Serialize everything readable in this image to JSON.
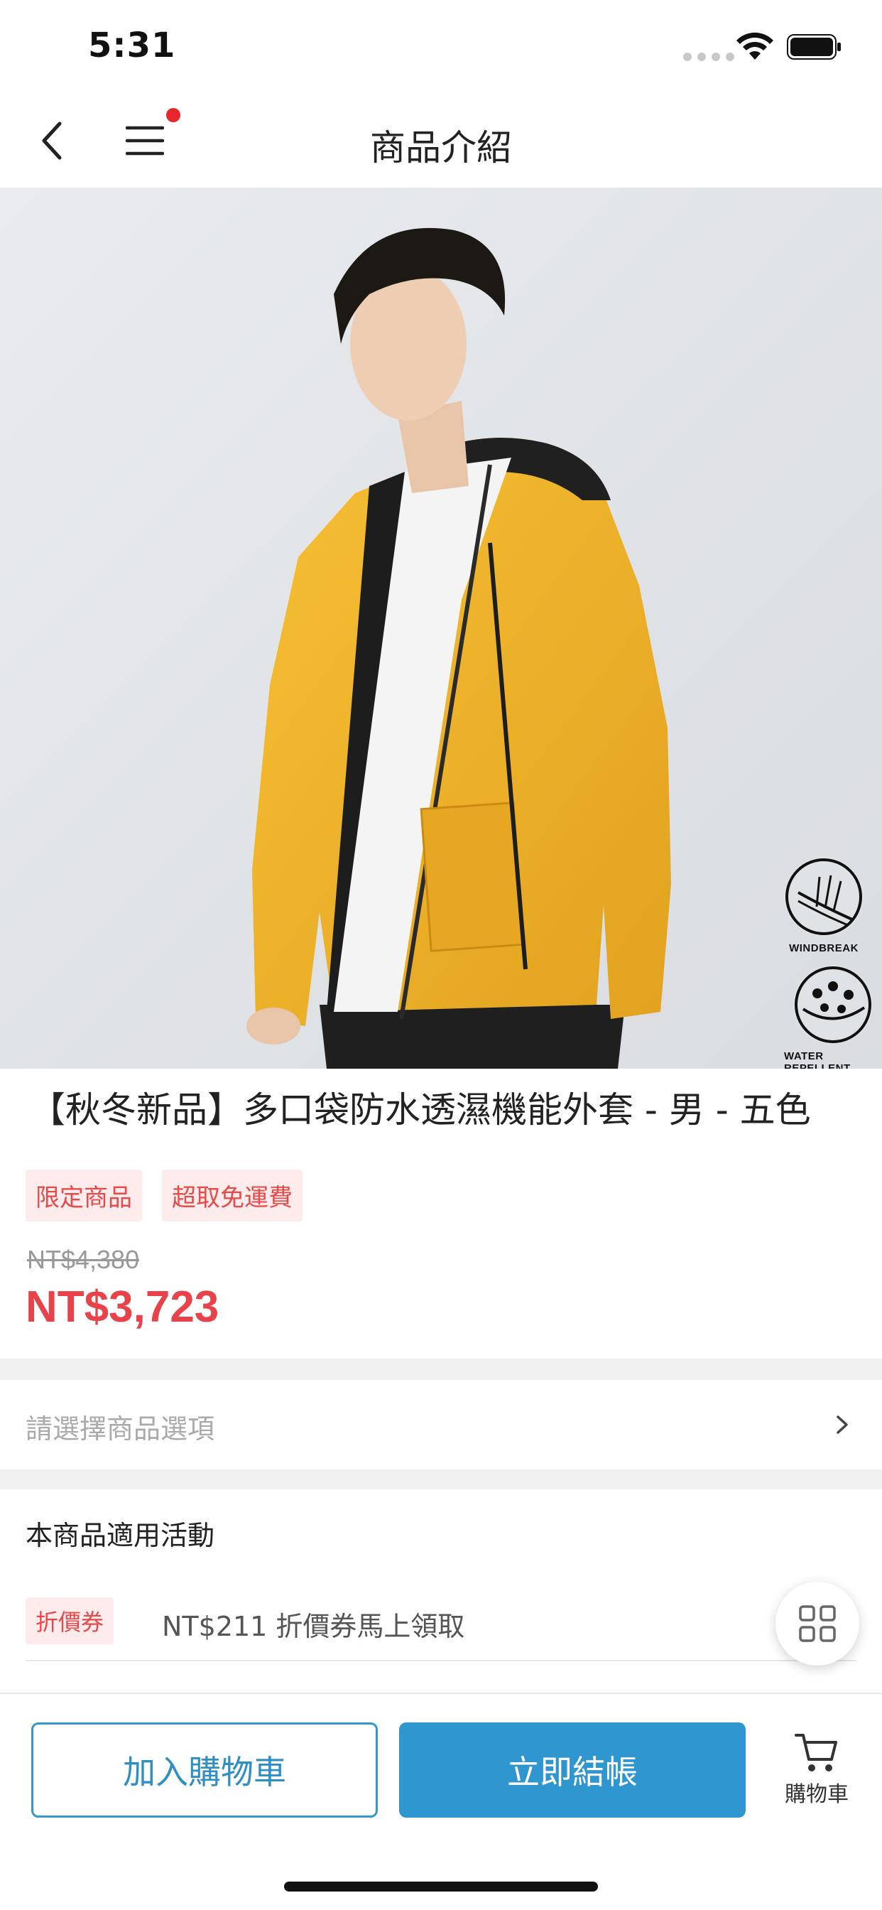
{
  "status_bar": {
    "time": "5:31"
  },
  "nav": {
    "title": "商品介紹"
  },
  "hero": {
    "badges": [
      {
        "label": "WINDBREAK",
        "icon": "windbreak-icon"
      },
      {
        "label": "WATER REPELLENT",
        "icon": "water-repellent-icon"
      }
    ]
  },
  "product": {
    "title": "【秋冬新品】多口袋防水透濕機能外套 - 男 - 五色",
    "tags": [
      "限定商品",
      "超取免運費"
    ],
    "original_price": "NT$4,380",
    "sale_price": "NT$3,723"
  },
  "options": {
    "placeholder": "請選擇商品選項"
  },
  "activity": {
    "title": "本商品適用活動",
    "coupon_tag": "折價券",
    "coupon_text": "NT$211 折價券馬上領取"
  },
  "bottom_bar": {
    "add_to_cart": "加入購物車",
    "checkout": "立即結帳",
    "cart": "購物車"
  },
  "colors": {
    "accent_blue": "#3096d0",
    "price_red": "#e8434a",
    "tag_bg": "#fdeceb",
    "jacket_yellow": "#f0b22a"
  }
}
